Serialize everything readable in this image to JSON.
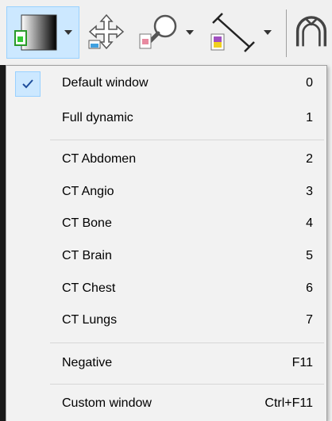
{
  "toolbar": {
    "buttons": [
      {
        "icon": "window-level-icon",
        "selected": true,
        "has_dropdown": true
      },
      {
        "icon": "pan-move-icon",
        "selected": false,
        "has_dropdown": false
      },
      {
        "icon": "zoom-magnifier-icon",
        "selected": false,
        "has_dropdown": true
      },
      {
        "icon": "measure-line-icon",
        "selected": false,
        "has_dropdown": true
      },
      {
        "icon": "rotate-3d-icon",
        "selected": false,
        "has_dropdown": false
      }
    ]
  },
  "menu": {
    "items": [
      {
        "label": "Default window",
        "shortcut": "0",
        "checked": true
      },
      {
        "label": "Full dynamic",
        "shortcut": "1",
        "checked": false
      },
      {
        "label": "CT Abdomen",
        "shortcut": "2",
        "checked": false
      },
      {
        "label": "CT Angio",
        "shortcut": "3",
        "checked": false
      },
      {
        "label": "CT Bone",
        "shortcut": "4",
        "checked": false
      },
      {
        "label": "CT Brain",
        "shortcut": "5",
        "checked": false
      },
      {
        "label": "CT Chest",
        "shortcut": "6",
        "checked": false
      },
      {
        "label": "CT Lungs",
        "shortcut": "7",
        "checked": false
      },
      {
        "label": "Negative",
        "shortcut": "F11",
        "checked": false
      },
      {
        "label": "Custom window",
        "shortcut": "Ctrl+F11",
        "checked": false
      }
    ]
  },
  "colors": {
    "accent_highlight": "#cce8ff",
    "accent_border": "#99d1ff",
    "check": "#1f4e9c"
  }
}
